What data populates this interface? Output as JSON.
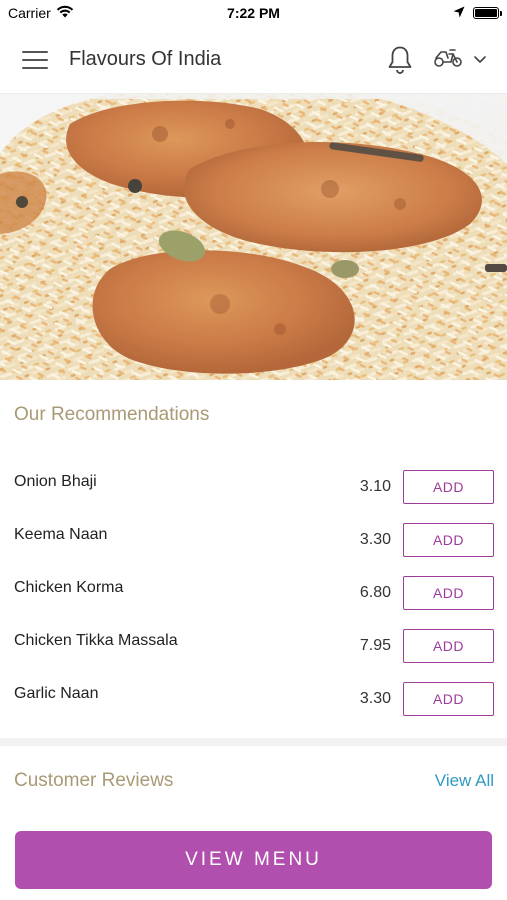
{
  "status_bar": {
    "carrier": "Carrier",
    "time": "7:22 PM",
    "icons": [
      "wifi-icon",
      "location-arrow-icon",
      "battery-icon"
    ]
  },
  "nav": {
    "title": "Flavours Of India",
    "icons": [
      "hamburger-menu-icon",
      "bell-icon",
      "scooter-icon",
      "chevron-down-icon"
    ]
  },
  "hero": {
    "image": "chicken biryani photo"
  },
  "recommendations": {
    "title": "Our Recommendations",
    "items": [
      {
        "name": "Onion Bhaji",
        "price": "3.10",
        "button": "ADD"
      },
      {
        "name": "Keema Naan",
        "price": "3.30",
        "button": "ADD"
      },
      {
        "name": "Chicken Korma",
        "price": "6.80",
        "button": "ADD"
      },
      {
        "name": "Chicken Tikka Massala",
        "price": "7.95",
        "button": "ADD"
      },
      {
        "name": "Garlic Naan",
        "price": "3.30",
        "button": "ADD"
      }
    ]
  },
  "reviews": {
    "title": "Customer Reviews",
    "view_all": "View All"
  },
  "footer": {
    "view_menu": "VIEW MENU"
  },
  "colors": {
    "accent": "#9c3d9a",
    "button_fill": "#b14fae",
    "section_title": "#a99a76",
    "link": "#2f9bc2"
  }
}
